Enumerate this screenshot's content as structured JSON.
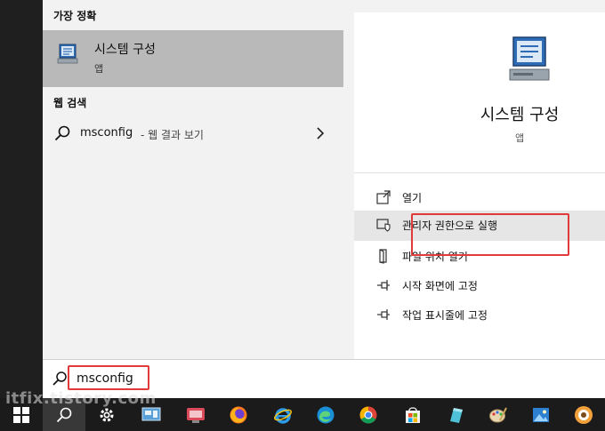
{
  "start_menu": {
    "best_match": {
      "section_title": "가장 정확",
      "app_name": "시스템 구성",
      "app_type": "앱",
      "icon": "system-configuration-icon"
    },
    "web_search": {
      "section_title": "웹 검색",
      "query": "msconfig",
      "suffix": "- 웹 결과 보기"
    },
    "detail": {
      "app_name": "시스템 구성",
      "app_type": "앱",
      "actions": [
        {
          "label": "열기",
          "icon": "open-icon"
        },
        {
          "label": "관리자 권한으로 실행",
          "icon": "shield-icon"
        },
        {
          "label": "파일 위치 열기",
          "icon": "file-location-icon"
        },
        {
          "label": "시작 화면에 고정",
          "icon": "pin-icon"
        },
        {
          "label": "작업 표시줄에 고정",
          "icon": "pin-icon"
        }
      ]
    }
  },
  "search_bar": {
    "value": "msconfig"
  },
  "taskbar": {
    "items": [
      "windows-start-icon",
      "search-icon",
      "settings-gear-icon",
      "app-icon",
      "app-icon",
      "firefox-icon",
      "internet-explorer-icon",
      "edge-icon",
      "chrome-icon",
      "store-icon",
      "app-icon",
      "paint-icon",
      "photos-icon",
      "app-icon"
    ]
  },
  "watermark": "itfix.tistory.com",
  "colors": {
    "highlight_box": "#e03a3a",
    "selected_item_bg": "#b9b9b9",
    "taskbar_bg": "#1b1b1b"
  }
}
